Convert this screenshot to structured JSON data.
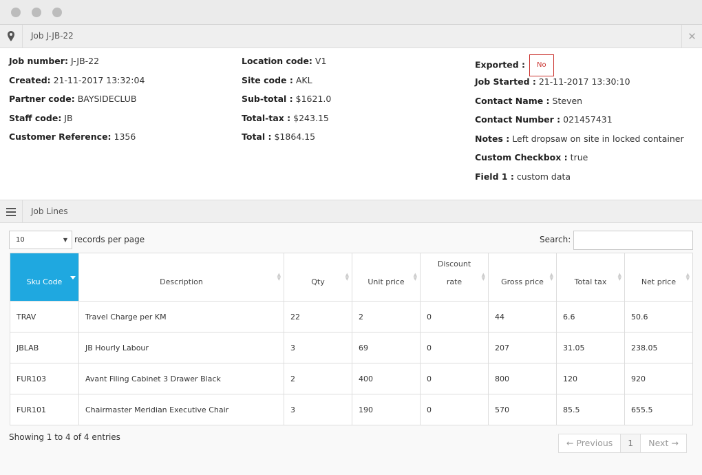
{
  "window": {
    "title": "Job J-JB-22"
  },
  "details": {
    "col1": [
      {
        "label": "Job number:",
        "value": "J-JB-22"
      },
      {
        "label": "Created:",
        "value": "21-11-2017 13:32:04"
      },
      {
        "label": "Partner code:",
        "value": "BAYSIDECLUB"
      },
      {
        "label": "Staff code:",
        "value": "JB"
      },
      {
        "label": "Customer Reference:",
        "value": "1356"
      }
    ],
    "col2": [
      {
        "label": "Location code:",
        "value": "V1"
      },
      {
        "label": "Site code :",
        "value": "AKL"
      },
      {
        "label": "Sub-total :",
        "value": "$1621.0"
      },
      {
        "label": "Total-tax :",
        "value": "$243.15"
      },
      {
        "label": "Total :",
        "value": "$1864.15"
      }
    ],
    "exported": {
      "label": "Exported :",
      "value": "No",
      "color": "#c9302c"
    },
    "col3": [
      {
        "label": "Job Started :",
        "value": "21-11-2017 13:30:10"
      },
      {
        "label": "Contact Name :",
        "value": "Steven"
      },
      {
        "label": "Contact Number :",
        "value": "021457431"
      },
      {
        "label": "Notes :",
        "value": "Left dropsaw on site in locked container"
      },
      {
        "label": "Custom Checkbox :",
        "value": "true"
      },
      {
        "label": "Field 1 :",
        "value": "custom data"
      }
    ]
  },
  "job_lines": {
    "title": "Job Lines",
    "page_length": "10",
    "page_length_label": "records per page",
    "search_label": "Search:",
    "search_value": "",
    "accent_color": "#1fa8e0",
    "sorted_column": "Sku Code",
    "columns": [
      "Sku Code",
      "Description",
      "Qty",
      "Unit price",
      "Discount rate",
      "Gross price",
      "Total tax",
      "Net price"
    ],
    "rows": [
      [
        "TRAV",
        "Travel Charge per KM",
        "22",
        "2",
        "0",
        "44",
        "6.6",
        "50.6"
      ],
      [
        "JBLAB",
        "JB Hourly Labour",
        "3",
        "69",
        "0",
        "207",
        "31.05",
        "238.05"
      ],
      [
        "FUR103",
        "Avant Filing Cabinet 3 Drawer Black",
        "2",
        "400",
        "0",
        "800",
        "120",
        "920"
      ],
      [
        "FUR101",
        "Chairmaster Meridian Executive Chair",
        "3",
        "190",
        "0",
        "570",
        "85.5",
        "655.5"
      ]
    ],
    "info": "Showing 1 to 4 of 4 entries",
    "pagination": {
      "previous": "← Previous",
      "current_page": "1",
      "next": "Next →"
    }
  }
}
